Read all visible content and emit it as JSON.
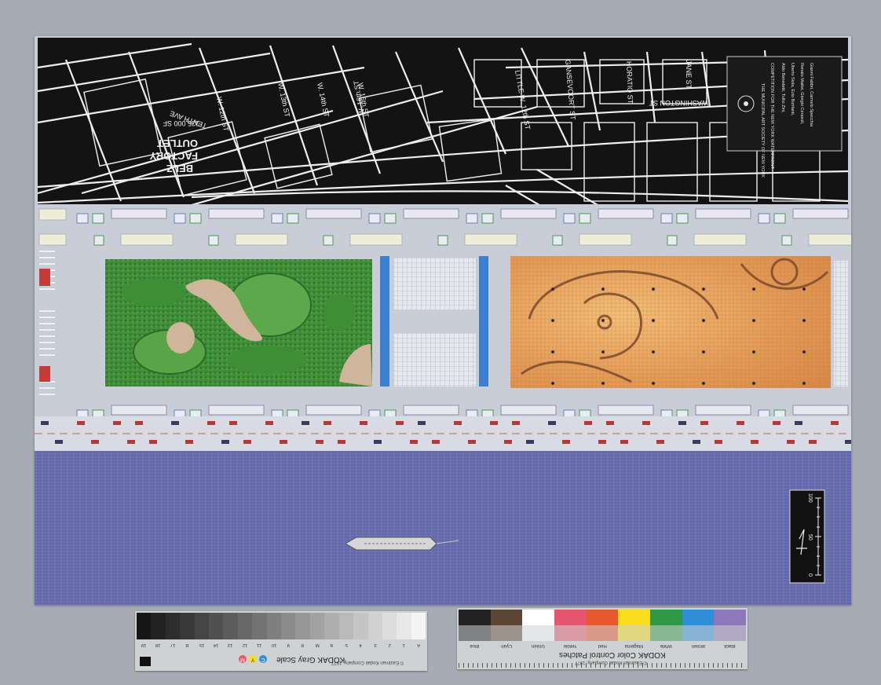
{
  "map": {
    "streets": [
      "W. 12th ST",
      "W. 13th ST",
      "W. 14th ST",
      "W. 15th ST",
      "W. 16th ST",
      "TENTH AVE",
      "LITTLE W. 12th ST",
      "GANSEVOORT ST",
      "HORATIO ST",
      "JANE ST",
      "WASHINGTON ST"
    ],
    "building_label": [
      "BELZ",
      "FACTORY",
      "OUTLET"
    ],
    "building_area": "335,000 SF"
  },
  "title_block": {
    "heading": "COMPETITION FOR THE NEW YORK WATERFRONT",
    "team": [
      "Aldo Benedetti, Tullio Zini,",
      "Uberto Siola, Ezio Bonfanti,",
      "Renato Mattei, Giorgio Cerasoli,",
      "Gianni Fabbri, Carmelo Specchia"
    ],
    "seal_text": "THE MUNICIPAL ART SOCIETY OF NEW YORK"
  },
  "scale_bar": {
    "top": "100",
    "mid": "50",
    "bottom": "0"
  },
  "gray_scale": {
    "title": "KODAK Gray Scale",
    "letters": [
      "C",
      "Y",
      "M"
    ],
    "steps": [
      "A",
      "1",
      "2",
      "3",
      "4",
      "5",
      "6",
      "M",
      "8",
      "9",
      "10",
      "11",
      "12",
      "13",
      "14",
      "15",
      "B",
      "17",
      "18",
      "19"
    ],
    "copyright": "© Eastman Kodak Company, 1977"
  },
  "color_patches": {
    "title": "KODAK Color Control Patches",
    "labels": [
      "Blue",
      "Cyan",
      "Green",
      "Yellow",
      "Red",
      "Magenta",
      "White",
      "Brown",
      "Black"
    ],
    "colors": [
      "#8f78b9",
      "#2f8ed8",
      "#2f9a45",
      "#f7dd1b",
      "#e9572c",
      "#e6566f",
      "#ffffff",
      "#5b4636",
      "#222222"
    ],
    "copyright": "© Eastman Kodak Company, 1977"
  }
}
